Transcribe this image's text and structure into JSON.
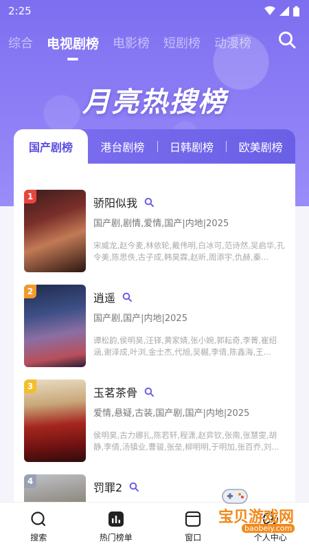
{
  "status": {
    "time": "2:25"
  },
  "top_tabs": [
    "综合",
    "电视剧榜",
    "电影榜",
    "短剧榜",
    "动漫榜"
  ],
  "active_top_tab": "电视剧榜",
  "hero_title": "月亮热搜榜",
  "sub_tabs": [
    "国产剧榜",
    "港台剧榜",
    "日韩剧榜",
    "欧美剧榜"
  ],
  "active_sub_tab": "国产剧榜",
  "items": [
    {
      "rank": "1",
      "title": "骄阳似我",
      "tags": "国产剧,剧情,爱情,国产|内地|2025",
      "cast": "宋威龙,赵今麦,林依轮,戴伟明,白冰可,范诗然,吴启华,孔令美,陈思佚,古子成,韩昊霖,赵昕,周添宇,仇赫,秦..."
    },
    {
      "rank": "2",
      "title": "逍遥",
      "tags": "国产剧,国产|内地|2025",
      "cast": "谭松韵,侯明昊,汪铎,黄家婧,张小婉,郭耘奇,李菁,崔绍涵,谢泽成,叶浏,金士杰,代旭,吴樾,李倩,陈鑫海,王..."
    },
    {
      "rank": "3",
      "title": "玉茗茶骨",
      "tags": "爱情,悬疑,古装,国产剧,国产|内地|2025",
      "cast": "侯明昊,古力娜扎,陈若轩,程潇,赵弈钦,张南,张慧雯,胡静,李倩,汤镇业,曹骏,张垒,柳明明,于明加,张百乔,刘..."
    },
    {
      "rank": "4",
      "title": "罚罪2",
      "tags": "",
      "cast": ""
    }
  ],
  "bottom_nav": [
    {
      "label": "搜索",
      "icon": "search-icon"
    },
    {
      "label": "热门榜单",
      "icon": "chart-icon"
    },
    {
      "label": "窗口",
      "icon": "window-icon"
    },
    {
      "label": "个人中心",
      "icon": "user-icon"
    }
  ],
  "watermark": {
    "text": "宝贝游戏网",
    "url": "baobeiy.com"
  },
  "colors": {
    "accent": "#6a5fe6",
    "hero": "#8b7cf5",
    "rank1": "#e8453c",
    "rank2": "#f39a2b",
    "rank3": "#f2bf2a",
    "rank4": "#9aa0b4"
  }
}
